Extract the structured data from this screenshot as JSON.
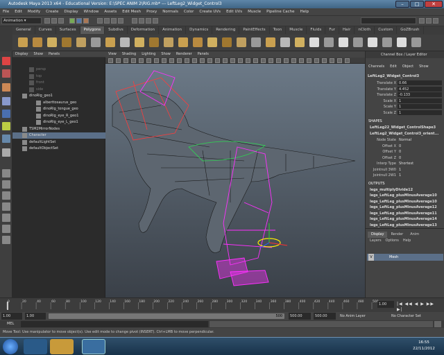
{
  "window": {
    "title": "Autodesk Maya 2013 x64 - Educational Version: E:\\SPEC ANIM 2\\RIG.mb*  ---  LeftLeg2_Widget_Control3",
    "controls": [
      "–",
      "□",
      "✕"
    ]
  },
  "menubar": [
    "File",
    "Edit",
    "Modify",
    "Create",
    "Display",
    "Window",
    "Assets",
    "Edit Mesh",
    "Proxy",
    "Normals",
    "Color",
    "Create UVs",
    "Edit UVs",
    "Muscle",
    "Pipeline Cache",
    "Help"
  ],
  "statusline": {
    "mode": "Animation"
  },
  "shelf": {
    "tabs": [
      "General",
      "Curves",
      "Surfaces",
      "Polygons",
      "Subdivs",
      "Deformation",
      "Animation",
      "Dynamics",
      "Rendering",
      "PaintEffects",
      "Toon",
      "Muscle",
      "Fluids",
      "Fur",
      "Hair",
      "nCloth",
      "Custom",
      "GoZBrush"
    ],
    "active_tab": "Polygons"
  },
  "outliner": {
    "menu": [
      "Display",
      "Show",
      "Panels"
    ],
    "items": [
      {
        "label": "persp",
        "indent": 1,
        "dim": true
      },
      {
        "label": "top",
        "indent": 1,
        "dim": true
      },
      {
        "label": "front",
        "indent": 1,
        "dim": true
      },
      {
        "label": "side",
        "indent": 1,
        "dim": true
      },
      {
        "label": "dinoRig_geo1",
        "indent": 0,
        "dim": false
      },
      {
        "label": "alberttosaurus_geo",
        "indent": 2,
        "dim": false
      },
      {
        "label": "dinoRig_tongue_geo",
        "indent": 2,
        "dim": false
      },
      {
        "label": "dinoRig_eye_R_geo1",
        "indent": 2,
        "dim": false
      },
      {
        "label": "dinoRig_eye_L_geo1",
        "indent": 2,
        "dim": false
      },
      {
        "label": "TSM2MirrorNodes",
        "indent": 0,
        "dim": false
      },
      {
        "label": "Character",
        "indent": 0,
        "dim": false,
        "selected": true
      },
      {
        "label": "defaultLightSet",
        "indent": 0,
        "dim": false
      },
      {
        "label": "defaultObjectSet",
        "indent": 0,
        "dim": false
      }
    ]
  },
  "viewport": {
    "menu": [
      "View",
      "Shading",
      "Lighting",
      "Show",
      "Renderer",
      "Panels"
    ]
  },
  "channelbox": {
    "menu": [
      "Channels",
      "Edit",
      "Object",
      "Show"
    ],
    "header": "Channel Box / Layer Editor",
    "object": "LeftLeg2_Widget_Control3",
    "channels": [
      {
        "label": "Translate X",
        "value": "0.66"
      },
      {
        "label": "Translate Y",
        "value": "4.452"
      },
      {
        "label": "Translate Z",
        "value": "-0.133"
      },
      {
        "label": "Scale X",
        "value": "1"
      },
      {
        "label": "Scale Y",
        "value": "1"
      },
      {
        "label": "Scale Z",
        "value": "1"
      }
    ],
    "shapes_title": "SHAPES",
    "shapes": [
      "LeftLeg22_Widget_ControlShape3",
      "LeftLeg2_Widget_Control3_orient..."
    ],
    "shape_channels": [
      {
        "label": "Node State",
        "value": "Normal"
      },
      {
        "label": "Offset X",
        "value": "0"
      },
      {
        "label": "Offset Y",
        "value": "0"
      },
      {
        "label": "Offset Z",
        "value": "0"
      },
      {
        "label": "Interp Type",
        "value": "Shortest"
      },
      {
        "label": "Jointnull 3W0",
        "value": "1"
      },
      {
        "label": "Jointnull 2W1",
        "value": "1"
      }
    ],
    "outputs_title": "OUTPUTS",
    "outputs": [
      "legs_multiplyDivide12",
      "legs_LeftLeg_plusMinusAverage10",
      "legs_LeftLeg_plusMinusAverage10",
      "legs_LeftLeg_plusMinusAverage12",
      "legs_LeftLeg_plusMinusAverage11",
      "legs_LeftLeg_plusMinusAverage14",
      "legs_LeftLeg_plusMinusAverage13"
    ]
  },
  "layers": {
    "tabs": [
      "Display",
      "Render",
      "Anim"
    ],
    "menu": [
      "Layers",
      "Options",
      "Help"
    ],
    "items": [
      {
        "v": "V",
        "label": "Mesh"
      }
    ]
  },
  "timeline": {
    "ticks": [
      "0",
      "20",
      "40",
      "60",
      "80",
      "100",
      "120",
      "140",
      "160",
      "180",
      "200",
      "220",
      "240",
      "260",
      "280",
      "300",
      "320",
      "340",
      "360",
      "380",
      "400",
      "420",
      "440",
      "460",
      "480",
      "500"
    ],
    "current_frame": "1.00"
  },
  "range": {
    "start": "1.00",
    "inner_start": "1.00",
    "inner_end": "500",
    "end": "500.00",
    "end2": "500.00",
    "anim_layer": "No Anim Layer",
    "character_set": "No Character Set"
  },
  "mel": {
    "label": "MEL"
  },
  "helpline": "Move Tool: Use manipulator to move object(s). Use edit mode to change pivot (INSERT). Ctrl+LMB to move perpendicular.",
  "taskbar": {
    "time": "16:55",
    "date": "22/11/2012"
  }
}
